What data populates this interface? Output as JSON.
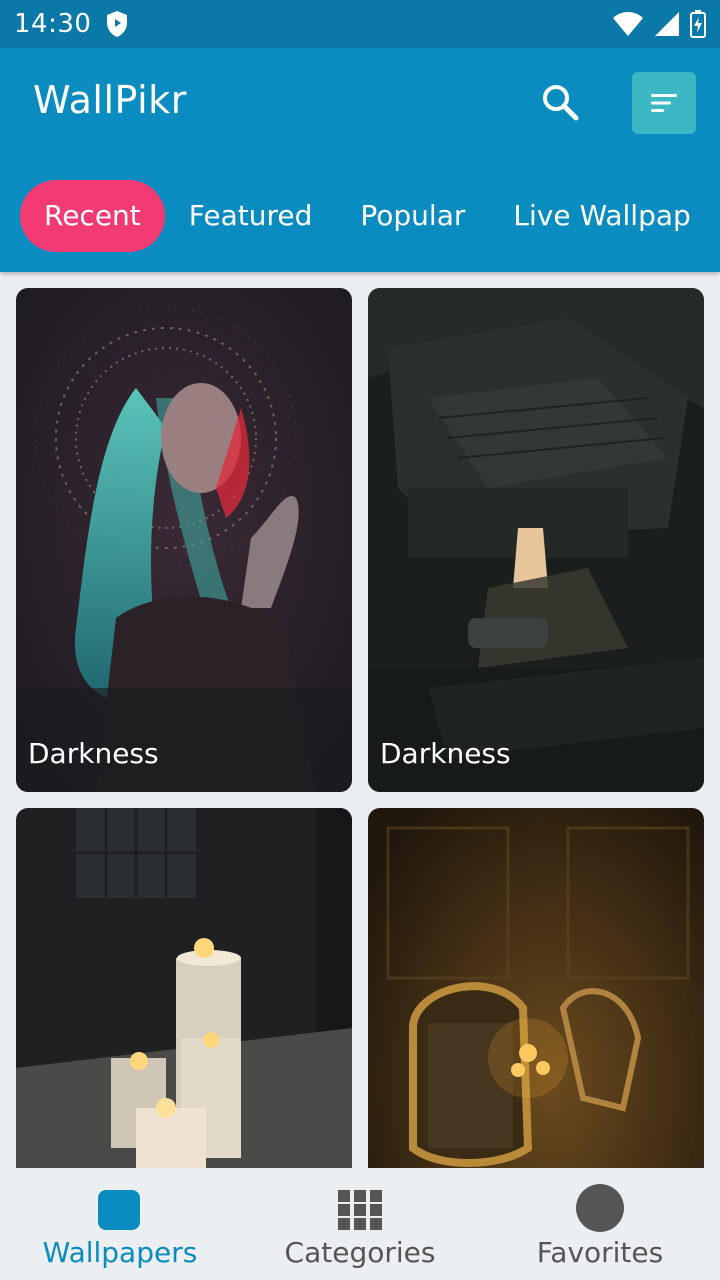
{
  "status_bar": {
    "time": "14:30",
    "icons": [
      "shield-icon",
      "wifi-icon",
      "signal-icon",
      "battery-icon"
    ]
  },
  "app_bar": {
    "title": "WallPikr",
    "search_icon": "search-icon",
    "menu_icon": "sort-menu-icon"
  },
  "tabs": [
    {
      "label": "Recent",
      "active": true
    },
    {
      "label": "Featured",
      "active": false
    },
    {
      "label": "Popular",
      "active": false
    },
    {
      "label": "Live Wallpap",
      "active": false
    }
  ],
  "wallpapers": [
    {
      "label": "Darkness",
      "scene": "portrait of woman with teal hair and ornate headdress"
    },
    {
      "label": "Darkness",
      "scene": "aerial view of dark rooftops with lit window"
    },
    {
      "label": "",
      "scene": "lit candles by a window"
    },
    {
      "label": "",
      "scene": "ornate gilded mirror and candle sconces"
    }
  ],
  "bottom_nav": [
    {
      "label": "Wallpapers",
      "icon": "wallpaper-icon",
      "active": true
    },
    {
      "label": "Categories",
      "icon": "grid-icon",
      "active": false
    },
    {
      "label": "Favorites",
      "icon": "favorites-icon",
      "active": false
    }
  ],
  "colors": {
    "status_bar": "#0a79a8",
    "app_bar": "#0a8cc0",
    "active_tab": "#f23b72",
    "menu_button": "#3cb8c4",
    "active_nav": "#0a8cc0"
  }
}
